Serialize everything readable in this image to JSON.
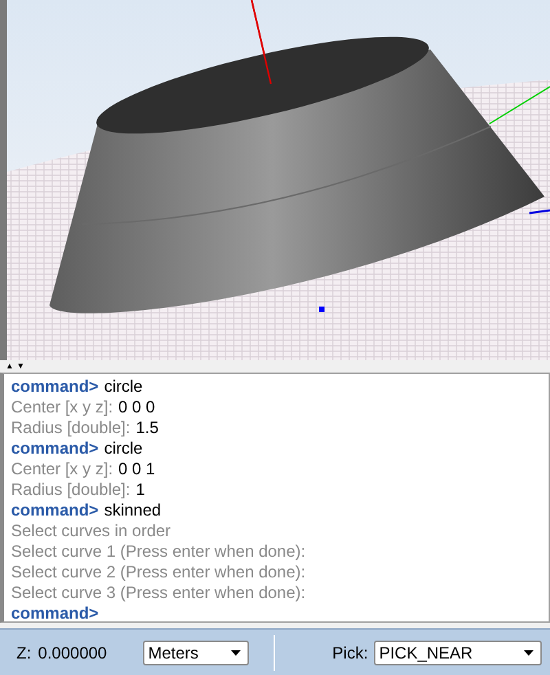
{
  "viewport": {
    "kind": "scene"
  },
  "splitter": {
    "up": "▲",
    "down": "▼"
  },
  "console": {
    "lines": [
      {
        "kind": "command",
        "prompt": "command>",
        "text": "circle"
      },
      {
        "kind": "input",
        "label": "Center [x y z]:",
        "value": "0 0 0"
      },
      {
        "kind": "input",
        "label": "Radius [double]:",
        "value": "1.5"
      },
      {
        "kind": "command",
        "prompt": "command>",
        "text": "circle"
      },
      {
        "kind": "input",
        "label": "Center [x y z]:",
        "value": "0 0 1"
      },
      {
        "kind": "input",
        "label": "Radius [double]:",
        "value": "1"
      },
      {
        "kind": "command",
        "prompt": "command>",
        "text": "skinned"
      },
      {
        "kind": "message",
        "text": "Select curves in order"
      },
      {
        "kind": "message",
        "text": "Select curve 1 (Press enter when done):"
      },
      {
        "kind": "message",
        "text": "Select curve 2 (Press enter when done):"
      },
      {
        "kind": "message",
        "text": "Select curve 3 (Press enter when done):"
      },
      {
        "kind": "command",
        "prompt": "command>"
      }
    ]
  },
  "status_bar": {
    "z_label": "Z:",
    "z_value": "0.000000",
    "units": "Meters",
    "pick_label": "Pick:",
    "pick_mode": "PICK_NEAR"
  }
}
